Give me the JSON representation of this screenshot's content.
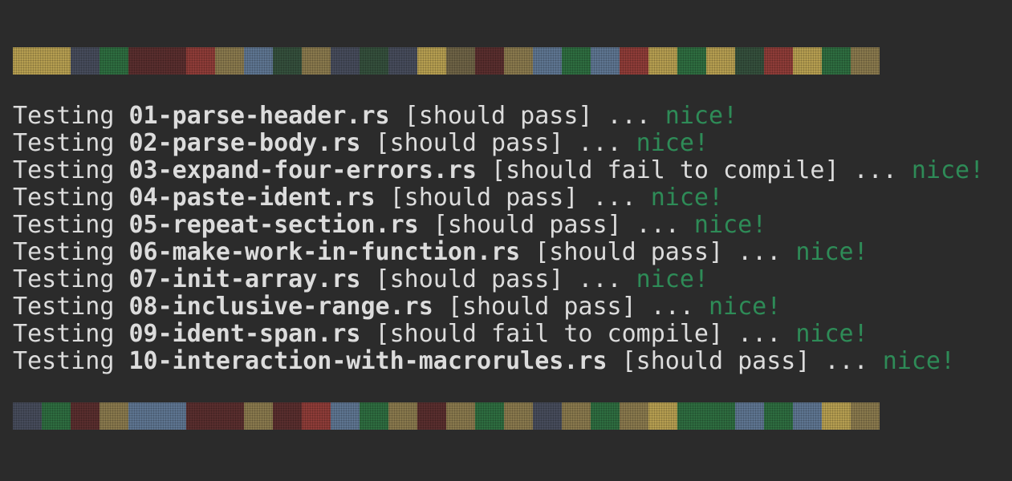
{
  "colors": {
    "background": "#2b2b2b",
    "text": "#dcdcdc",
    "success": "#2e8b57"
  },
  "top_strip": [
    "#b8a052",
    "#b8a052",
    "#474c5c",
    "#2e6e40",
    "#5a2e2e",
    "#5a2e2e",
    "#8f3c38",
    "#8a7a4e",
    "#5f7692",
    "#35503d",
    "#8a7a4e",
    "#474c5c",
    "#35503d",
    "#474c5c",
    "#b8a052",
    "#6f6446",
    "#5a2e2e",
    "#8a7a4e",
    "#5f7692",
    "#2e6e40",
    "#5f7692",
    "#8f3c38",
    "#b8a052",
    "#2e6e40",
    "#b8a052",
    "#35503d",
    "#8f3c38",
    "#b8a052",
    "#2e6e40",
    "#8a7a4e"
  ],
  "bottom_strip": [
    "#474c5c",
    "#2e6e40",
    "#5a2e2e",
    "#8a7a4e",
    "#5f7692",
    "#5f7692",
    "#5a2e2e",
    "#5a2e2e",
    "#8a7a4e",
    "#5a2e2e",
    "#8f3c38",
    "#5f7692",
    "#2e6e40",
    "#8a7a4e",
    "#5a2e2e",
    "#8a7a4e",
    "#2e6e40",
    "#8a7a4e",
    "#474c5c",
    "#8a7a4e",
    "#2e6e40",
    "#8a7a4e",
    "#b8a052",
    "#2e6e40",
    "#2e6e40",
    "#5f7692",
    "#2e6e40",
    "#5f7692",
    "#b8a052",
    "#8a7a4e"
  ],
  "tests": [
    {
      "prefix": "Testing ",
      "file": "01-parse-header.rs",
      "expect": " [should pass] ... ",
      "result": "nice!"
    },
    {
      "prefix": "Testing ",
      "file": "02-parse-body.rs",
      "expect": " [should pass] ... ",
      "result": "nice!"
    },
    {
      "prefix": "Testing ",
      "file": "03-expand-four-errors.rs",
      "expect": " [should fail to compile] ... ",
      "result": "nice!"
    },
    {
      "prefix": "Testing ",
      "file": "04-paste-ident.rs",
      "expect": " [should pass] ... ",
      "result": "nice!"
    },
    {
      "prefix": "Testing ",
      "file": "05-repeat-section.rs",
      "expect": " [should pass] ... ",
      "result": "nice!"
    },
    {
      "prefix": "Testing ",
      "file": "06-make-work-in-function.rs",
      "expect": " [should pass] ... ",
      "result": "nice!"
    },
    {
      "prefix": "Testing ",
      "file": "07-init-array.rs",
      "expect": " [should pass] ... ",
      "result": "nice!"
    },
    {
      "prefix": "Testing ",
      "file": "08-inclusive-range.rs",
      "expect": " [should pass] ... ",
      "result": "nice!"
    },
    {
      "prefix": "Testing ",
      "file": "09-ident-span.rs",
      "expect": " [should fail to compile] ... ",
      "result": "nice!"
    },
    {
      "prefix": "Testing ",
      "file": "10-interaction-with-macrorules.rs",
      "expect": " [should pass] ... ",
      "result": "nice!"
    }
  ]
}
